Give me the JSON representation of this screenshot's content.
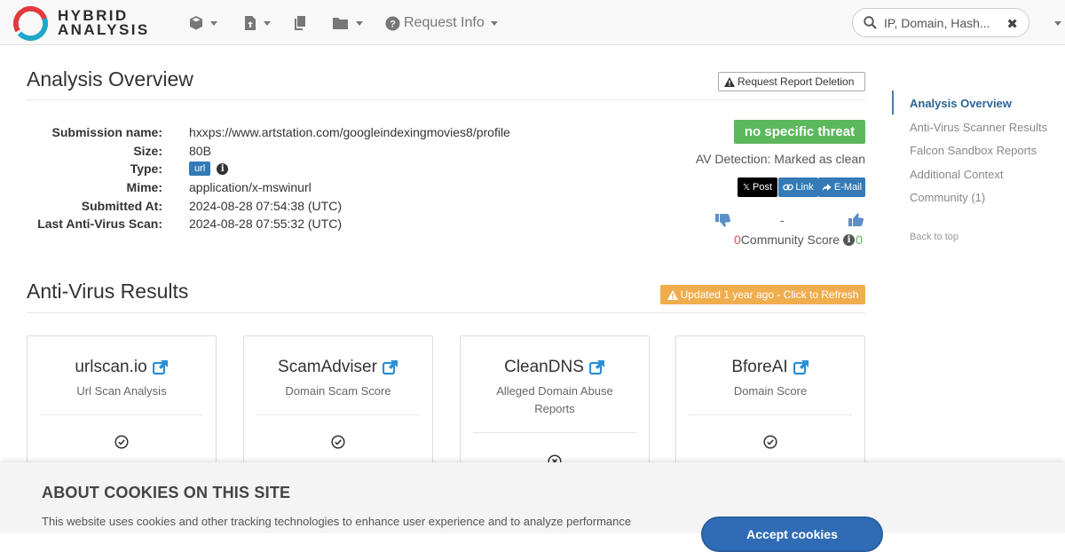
{
  "app": {
    "logo_line1": "HYBRID",
    "logo_line2": "ANALYSIS"
  },
  "nav": {
    "request_info": "Request Info",
    "search_placeholder": "IP, Domain, Hash...",
    "search_value": ""
  },
  "overview": {
    "title": "Analysis Overview",
    "delete_button": "Request Report Deletion",
    "fields": [
      {
        "key": "Submission name:",
        "value": "hxxps://www.artstation.com/googleindexingmovies8/profile"
      },
      {
        "key": "Size:",
        "value": "80B"
      },
      {
        "key": "Type:",
        "value": "url"
      },
      {
        "key": "Mime:",
        "value": "application/x-mswinurl"
      },
      {
        "key": "Submitted At:",
        "value": "2024-08-28 07:54:38 (UTC)"
      },
      {
        "key": "Last Anti-Virus Scan:",
        "value": "2024-08-28 07:55:32 (UTC)"
      }
    ],
    "threat_label": "no specific threat",
    "av_detection": "AV Detection: Marked as clean",
    "share_post": "Post",
    "share_link": "Link",
    "share_email": "E-Mail",
    "vote_separator": "-",
    "downvotes": "0",
    "upvotes": "0",
    "community_label": "Community Score"
  },
  "av_results": {
    "title": "Anti-Virus Results",
    "refresh_label": "Updated 1 year ago - Click to Refresh",
    "cards": [
      {
        "name": "urlscan.io",
        "subtitle": "Url Scan Analysis",
        "status": "clean"
      },
      {
        "name": "ScamAdviser",
        "subtitle": "Domain Scam Score",
        "status": "clean"
      },
      {
        "name": "CleanDNS",
        "subtitle": "Alleged Domain Abuse Reports",
        "status": "none"
      },
      {
        "name": "BforeAI",
        "subtitle": "Domain Score",
        "status": "clean"
      }
    ]
  },
  "sidenav": {
    "items": [
      "Analysis Overview",
      "Anti-Virus Scanner Results",
      "Falcon Sandbox Reports",
      "Additional Context",
      "Community (1)"
    ],
    "back_to_top": "Back to top"
  },
  "cookie": {
    "title": "ABOUT COOKIES ON THIS SITE",
    "text": "This website uses cookies and other tracking technologies to enhance user experience and to analyze performance",
    "button": "Accept cookies"
  },
  "colors": {
    "threat_green": "#5cb85c",
    "refresh_orange": "#f0ad4e",
    "link_blue": "#337ab7",
    "vote_down_red": "#d9534f",
    "vote_up_green": "#5cb85c"
  }
}
